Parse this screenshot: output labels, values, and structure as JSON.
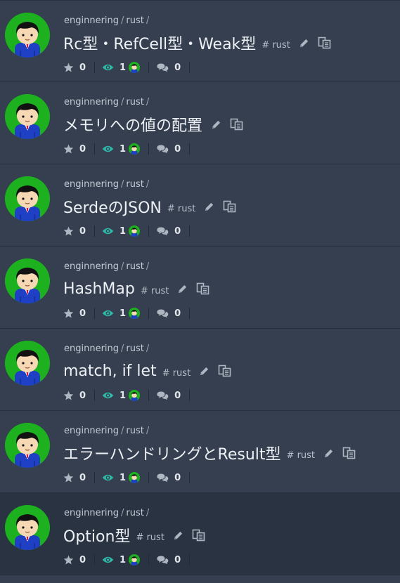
{
  "path_sep": "/",
  "colors": {
    "background": "#353f4f",
    "selected_background": "#2a3342",
    "avatar_green": "#1db11f",
    "watch_teal": "#2fb7a8",
    "icon_gray": "#aeb6c1"
  },
  "icons": {
    "star": "star-icon",
    "eye": "eye-icon",
    "comment": "comment-icon",
    "edit": "pencil-icon",
    "copy": "copy-icon"
  },
  "posts": [
    {
      "category": "enginnering",
      "subcategory": "rust",
      "title": "Rc型・RefCell型・Weak型",
      "tag": "# rust",
      "stars": "0",
      "watchers": "1",
      "comments": "0"
    },
    {
      "category": "enginnering",
      "subcategory": "rust",
      "title": "メモリへの値の配置",
      "tag": "",
      "stars": "0",
      "watchers": "1",
      "comments": "0"
    },
    {
      "category": "enginnering",
      "subcategory": "rust",
      "title": "SerdeのJSON",
      "tag": "# rust",
      "stars": "0",
      "watchers": "1",
      "comments": "0"
    },
    {
      "category": "enginnering",
      "subcategory": "rust",
      "title": "HashMap",
      "tag": "# rust",
      "stars": "0",
      "watchers": "1",
      "comments": "0"
    },
    {
      "category": "enginnering",
      "subcategory": "rust",
      "title": "match, if let",
      "tag": "# rust",
      "stars": "0",
      "watchers": "1",
      "comments": "0"
    },
    {
      "category": "enginnering",
      "subcategory": "rust",
      "title": "エラーハンドリングとResult型",
      "tag": "# rust",
      "stars": "0",
      "watchers": "1",
      "comments": "0"
    },
    {
      "category": "enginnering",
      "subcategory": "rust",
      "title": "Option型",
      "tag": "# rust",
      "stars": "0",
      "watchers": "1",
      "comments": "0"
    }
  ]
}
